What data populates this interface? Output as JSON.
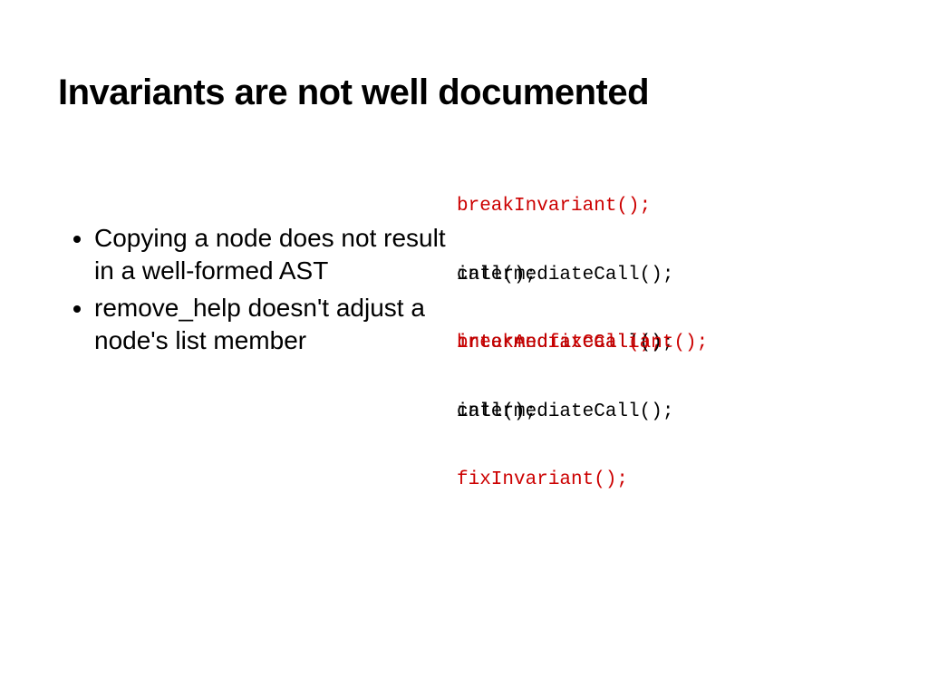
{
  "title": "Invariants are not well documented",
  "bullets": [
    "Copying a node does not result in a well-formed AST",
    "remove_help doesn't adjust a node's list member"
  ],
  "code": {
    "layerA": [
      {
        "text": "breakInvariant();",
        "cls": "red"
      },
      {
        "text": "",
        "cls": "blk"
      },
      {
        "text": "",
        "cls": "blk"
      },
      {
        "text": "intermediateCall();",
        "cls": "blk"
      },
      {
        "text": "",
        "cls": "blk"
      },
      {
        "text": "",
        "cls": "blk"
      },
      {
        "text": "breakAndfixCall();",
        "cls": "red"
      },
      {
        "text": "",
        "cls": "blk"
      },
      {
        "text": "",
        "cls": "blk"
      },
      {
        "text": "intermediateCall();",
        "cls": "blk"
      },
      {
        "text": "",
        "cls": "blk"
      },
      {
        "text": "",
        "cls": "blk"
      },
      {
        "text": "fixInvariant();",
        "cls": "red"
      }
    ],
    "layerB": [
      {
        "text": "",
        "cls": "blk"
      },
      {
        "text": "",
        "cls": "blk"
      },
      {
        "text": "",
        "cls": "blk"
      },
      {
        "text": "call();",
        "cls": "blk"
      },
      {
        "text": "",
        "cls": "blk"
      },
      {
        "text": "",
        "cls": "blk"
      },
      {
        "text": "intermediateCall();",
        "cls": "blk"
      },
      {
        "text": "",
        "cls": "blk"
      },
      {
        "text": "",
        "cls": "blk"
      },
      {
        "text": "call();",
        "cls": "blk"
      },
      {
        "text": "",
        "cls": "blk"
      },
      {
        "text": "",
        "cls": "blk"
      },
      {
        "text": "",
        "cls": "blk"
      }
    ],
    "layerC": [
      {
        "text": "",
        "cls": "blk"
      },
      {
        "text": "",
        "cls": "blk"
      },
      {
        "text": "",
        "cls": "blk"
      },
      {
        "text": "",
        "cls": "blk"
      },
      {
        "text": "",
        "cls": "blk"
      },
      {
        "text": "",
        "cls": "blk"
      },
      {
        "text": "intermediateCaliant();",
        "cls": "red"
      },
      {
        "text": "",
        "cls": "blk"
      },
      {
        "text": "",
        "cls": "blk"
      },
      {
        "text": "",
        "cls": "blk"
      },
      {
        "text": "",
        "cls": "blk"
      },
      {
        "text": "",
        "cls": "blk"
      },
      {
        "text": "",
        "cls": "blk"
      }
    ]
  }
}
